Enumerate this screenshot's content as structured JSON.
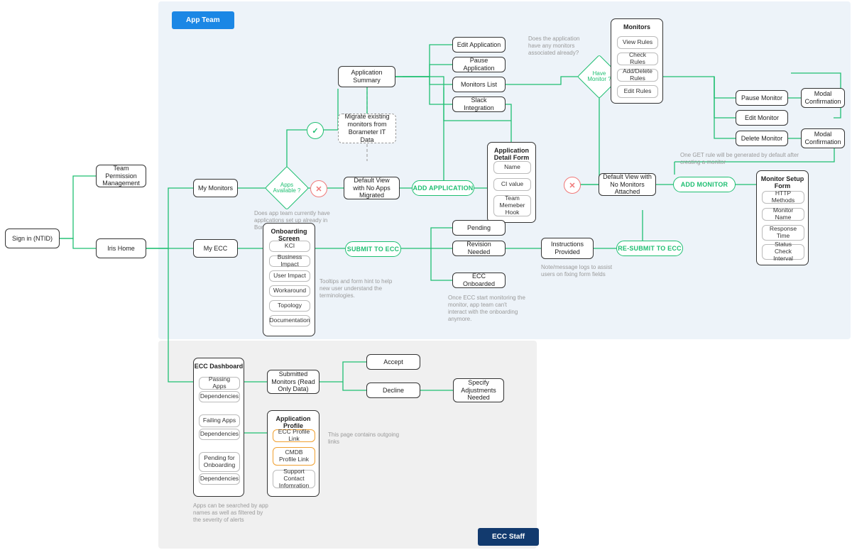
{
  "zones": {
    "top_bg": "#edf3f9",
    "bottom_bg": "#f0f0f0"
  },
  "tags": {
    "app_team": "App Team",
    "ecc_staff": "ECC Staff"
  },
  "colors": {
    "tag_blue": "#1b87e5",
    "tag_navy": "#123a6e",
    "green": "#1fbf72",
    "red": "#f07878",
    "orange": "#f0a030"
  },
  "nodes": {
    "sign_in": "Sign in (NTID)",
    "team_perm": "Team Permission Management",
    "iris_home": "Iris Home",
    "my_monitors": "My Monitors",
    "my_ecc": "My ECC",
    "migrate": "Migrate existing monitors from Borameter IT Data",
    "default_no_apps": "Default View with No Apps Migrated",
    "default_no_monitors": "Default View with No Monitors Attached",
    "app_summary": "Application Summary",
    "edit_app": "Edit Application",
    "pause_app": "Pause Application",
    "monitors_list": "Monitors List",
    "slack": "Slack Integration",
    "pending": "Pending",
    "revision": "Revision Needed",
    "ecc_onboarded": "ECC Onboarded",
    "instructions": "Instructions Provided",
    "pause_monitor": "Pause Monitor",
    "edit_monitor": "Edit Monitor",
    "delete_monitor": "Delete Monitor",
    "modal_conf1": "Modal Confirmation",
    "modal_conf2": "Modal Confirmation",
    "submitted_monitors": "Submitted Monitors (Read Only Data)",
    "accept": "Accept",
    "decline": "Decline",
    "adjustments": "Specify Adjustments Needed"
  },
  "panels": {
    "onboarding": {
      "title": "Onboarding Screen",
      "items": [
        "KCI",
        "Business Impact",
        "User Impact",
        "Workaround",
        "Topology",
        "Documentation"
      ]
    },
    "app_detail": {
      "title": "Application Detail Form",
      "items": [
        "Name",
        "CI value",
        "Team Memeber Hook"
      ]
    },
    "monitors": {
      "title": "Monitors",
      "items": [
        "View Rules",
        "Check Rules",
        "Add/Delete Rules",
        "Edit Rules"
      ]
    },
    "monitor_setup": {
      "title": "Monitor Setup Form",
      "items": [
        "HTTP Methods",
        "Monitor Name",
        "Response Time",
        "Status Check Interval"
      ]
    },
    "ecc_dashboard": {
      "title": "ECC Dashboard",
      "groups": [
        {
          "h": "Passing Apps",
          "s": "Dependencies"
        },
        {
          "h": "Failing Apps",
          "s": "Dependencies"
        },
        {
          "h": "Pending for Onboarding",
          "s": "Dependencies"
        }
      ]
    },
    "app_profile": {
      "title": "Application Profile",
      "items": [
        "ECC  Profile  Link",
        "CMDB Profile Link",
        "Support Contact Infomration"
      ],
      "orange": [
        0,
        1
      ]
    }
  },
  "pills": {
    "add_app": "ADD APPLICATION",
    "submit": "SUBMIT TO ECC",
    "resubmit": "RE-SUBMIT TO ECC",
    "add_mon": "ADD MONITOR"
  },
  "diamonds": {
    "apps_avail": "Apps Available ?",
    "have_monitor": "Have Monitor ?"
  },
  "marks": {
    "yes": "✓",
    "no": "✕"
  },
  "notes": {
    "apps_setup": "Does app team currently have applications set up already in Borameter IT ?",
    "tooltips": "Tooltips and form hint to help new user understand the terminologies.",
    "ecc_locked": "Once ECC start monitoring the monitor, app team can't interact with the onboarding anymore.",
    "assist": "Note/message logs to assist users on fixing form fields",
    "default_rule": "One GET rule will be generated by default after creating a monitor",
    "has_monitors": "Does the application have any monitors associated already?",
    "searched": "Apps can be searched by app names as well as filtered by the severity of alerts",
    "outgoing": "This page contains outgoing links"
  }
}
